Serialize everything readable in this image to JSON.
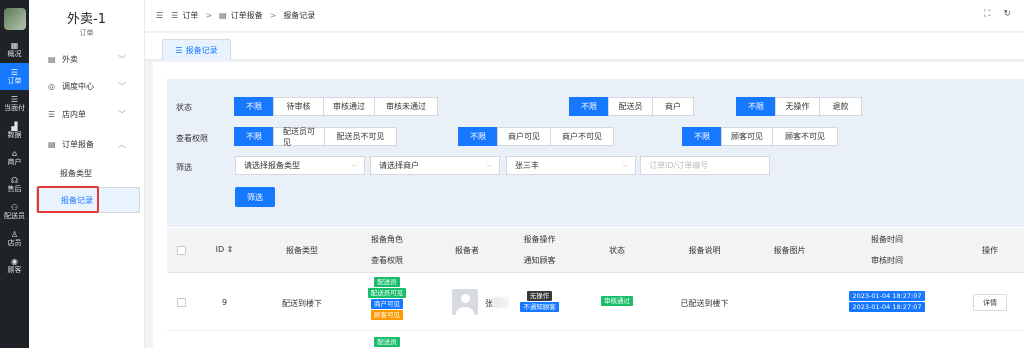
{
  "rail": {
    "items": [
      {
        "label": "概况",
        "icon": "grid-icon"
      },
      {
        "label": "订单",
        "icon": "list-icon"
      },
      {
        "label": "当面付",
        "icon": "list-icon"
      },
      {
        "label": "数据",
        "icon": "bar-chart-icon"
      },
      {
        "label": "商户",
        "icon": "store-icon"
      },
      {
        "label": "售后",
        "icon": "headset-icon"
      },
      {
        "label": "配送员",
        "icon": "rider-icon"
      },
      {
        "label": "店员",
        "icon": "user-icon"
      },
      {
        "label": "顾客",
        "icon": "customer-icon"
      }
    ],
    "active_index": 1
  },
  "sidebar": {
    "title": "外卖-1",
    "subtitle": "订单",
    "items": [
      {
        "label": "外卖",
        "icon": "doc-icon",
        "chevron": "﹀"
      },
      {
        "label": "调度中心",
        "icon": "location-icon",
        "chevron": "﹀"
      },
      {
        "label": "店内单",
        "icon": "list-icon",
        "chevron": "﹀"
      },
      {
        "label": "订单报备",
        "icon": "doc-icon",
        "chevron": "︿"
      }
    ],
    "sub_items": [
      {
        "label": "报备类型"
      },
      {
        "label": "报备记录"
      }
    ]
  },
  "topbar": {
    "toggle_icon": "☰",
    "breadcrumb": [
      "订单",
      "订单报备",
      "报备记录"
    ],
    "sep": ">"
  },
  "tab": {
    "label": "报备记录"
  },
  "filters": {
    "status_label": "状态",
    "status_options": [
      "不限",
      "待审核",
      "审核通过",
      "审核未通过"
    ],
    "role_options": [
      "不限",
      "配送员",
      "商户"
    ],
    "action_options": [
      "不限",
      "无操作",
      "退款"
    ],
    "perm_label": "查看权限",
    "rider_vis_options": [
      "不限",
      "配送员可见",
      "配送员不可见"
    ],
    "merchant_vis_options": [
      "不限",
      "商户可见",
      "商户不可见"
    ],
    "customer_vis_options": [
      "不限",
      "顾客可见",
      "顾客不可见"
    ],
    "filter_label": "筛选",
    "type_select": "请选择报备类型",
    "merchant_select": "请选择商户",
    "reporter_select": "张三丰",
    "order_placeholder": "订单ID/订单编号",
    "submit": "筛选"
  },
  "table": {
    "headers": {
      "id": "ID ⇕",
      "type": "报备类型",
      "role_top": "报备角色",
      "role_bottom": "查看权限",
      "reporter": "报备者",
      "action_top": "报备操作",
      "action_bottom": "通知顾客",
      "status": "状态",
      "desc": "报备说明",
      "image": "报备图片",
      "time_top": "报备时间",
      "time_bottom": "审核时间",
      "op": "操作"
    },
    "rows": [
      {
        "id": "9",
        "type": "配送到楼下",
        "role_tags": [
          "配送员",
          "配送员可见",
          "商户可见",
          "顾客可见"
        ],
        "reporter_name": "张",
        "action": "无操作",
        "notify": "不通知顾客",
        "status": "审核通过",
        "desc": "已配送到楼下",
        "report_time": "2023-01-04 18:27:07",
        "audit_time": "2023-01-04 18:27:07",
        "op": "详情"
      },
      {
        "role_tags": [
          "配送员"
        ]
      }
    ]
  },
  "colors": {
    "primary": "#1677ff",
    "green": "#19be6b",
    "orange": "#ff9900",
    "dark": "#3a3a3a",
    "alert": "#e53935"
  }
}
